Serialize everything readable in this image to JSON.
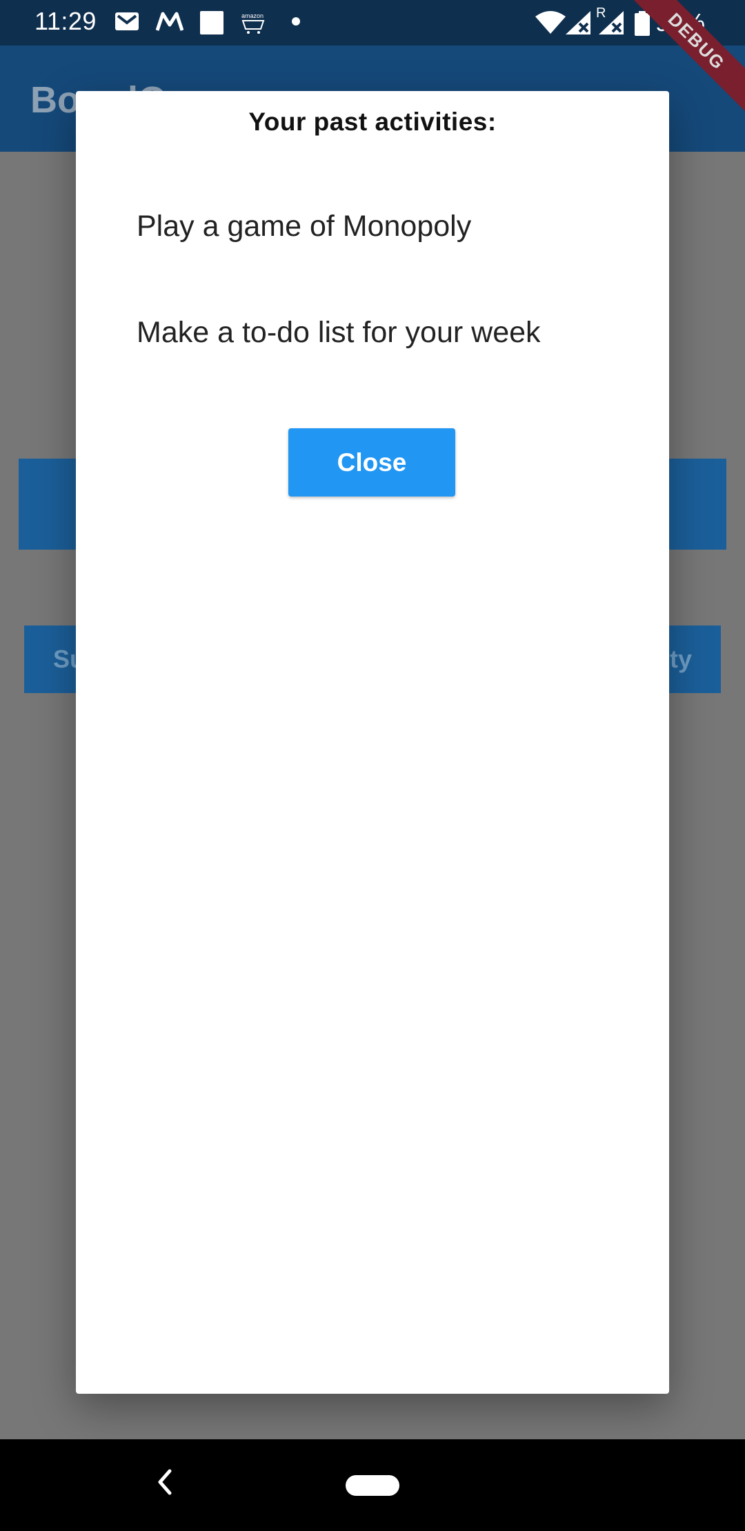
{
  "status_bar": {
    "time": "11:29",
    "battery": "97%",
    "icons": [
      "gmail-icon",
      "motorola-icon",
      "square-icon",
      "amazon-icon",
      "dot-icon",
      "wifi-icon",
      "signal-icon",
      "roaming-signal-icon",
      "battery-icon"
    ],
    "roaming_label": "R"
  },
  "app_bar": {
    "title": "BoardQ"
  },
  "background": {
    "left_button_label": "Su",
    "right_button_label": "ty"
  },
  "debug_ribbon": "DEBUG",
  "dialog": {
    "title": "Your past activities:",
    "activities": [
      "Play a game of Monopoly",
      "Make a to-do list for your week"
    ],
    "close_label": "Close"
  },
  "colors": {
    "primary": "#2196f3",
    "scrim": "#777777",
    "status_bar": "#0f2f4e"
  }
}
